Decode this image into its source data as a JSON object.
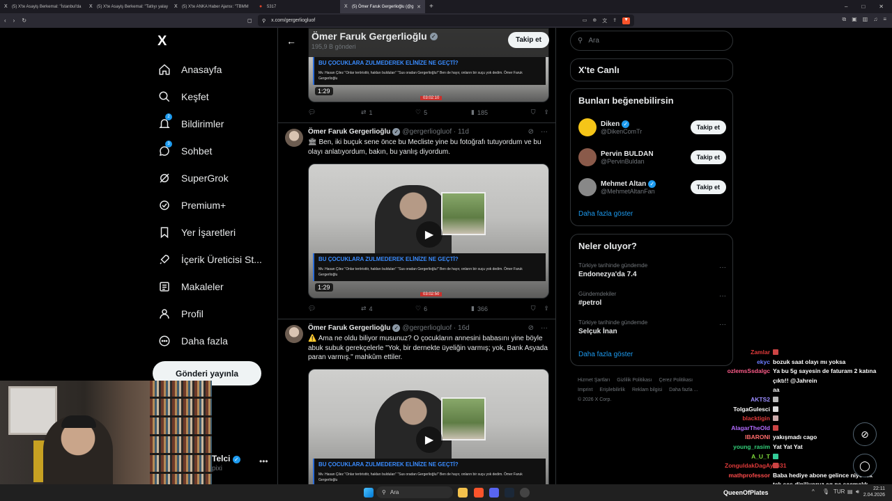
{
  "browser": {
    "tabs": [
      {
        "label": "(5) X'te Asayiş Berkemal: \"İstanbul'da",
        "active": false
      },
      {
        "label": "(5) X'te Asayiş Berkemal: \"Tatlıyı yalay",
        "active": false
      },
      {
        "label": "(5) X'te ANKA Haber Ajansı: \"TBMM",
        "active": false
      },
      {
        "label": "5317",
        "active": false
      },
      {
        "label": "(5) Ömer Faruk Gergerlioğlu (@g",
        "active": true
      }
    ],
    "new_tab": "+",
    "url": "x.com/gergerliogluof"
  },
  "sidebar": {
    "logo": "X",
    "items": [
      {
        "label": "Anasayfa",
        "icon": "home-icon",
        "badge": ""
      },
      {
        "label": "Keşfet",
        "icon": "search-icon",
        "badge": ""
      },
      {
        "label": "Bildirimler",
        "icon": "bell-icon",
        "badge": "2"
      },
      {
        "label": "Sohbet",
        "icon": "chat-icon",
        "badge": "3"
      },
      {
        "label": "SuperGrok",
        "icon": "grok-icon",
        "badge": ""
      },
      {
        "label": "Premium+",
        "icon": "premium-icon",
        "badge": ""
      },
      {
        "label": "Yer İşaretleri",
        "icon": "bookmark-icon",
        "badge": ""
      },
      {
        "label": "İçerik Üreticisi St...",
        "icon": "rocket-icon",
        "badge": ""
      },
      {
        "label": "Makaleler",
        "icon": "article-icon",
        "badge": ""
      },
      {
        "label": "Profil",
        "icon": "person-icon",
        "badge": ""
      },
      {
        "label": "Daha fazla",
        "icon": "more-icon",
        "badge": ""
      }
    ],
    "post_button": "Gönderi yayınla",
    "account_name": "Telci",
    "account_handle": "pixi"
  },
  "profile_header": {
    "name": "Ömer Faruk Gergerlioğlu",
    "subtitle": "195,9 B gönderi",
    "follow": "Takip et"
  },
  "posts": [
    {
      "author": "",
      "handle": "",
      "time": "",
      "text": "",
      "caption_title": "BU ÇOCUKLARA ZULMEDEREK ELİNİZE NE GEÇTİ?",
      "caption_body": "Mv. Hasan Çilez \"Onlar teröristtir, hakları bulduları\" \"Sus oradan Gergerlioğlu!\" Ben de hayır, onların bir suçu yok dedim. Ömer Faruk Gergerlioğlu",
      "duration": "1:29",
      "red_tag": "03:02:10",
      "replies": "",
      "reposts": "1",
      "likes": "5",
      "views": "185"
    },
    {
      "author": "Ömer Faruk Gergerlioğlu",
      "handle": "@gergerliogluof · 11d",
      "time": "",
      "emoji": "🏛",
      "text": "Ben, iki buçuk sene önce bu Mecliste yine bu fotoğrafı tutuyordum ve bu olayı anlatıyordum, bakın, bu yanlış diyordum.",
      "caption_title": "BU ÇOCUKLARA ZULMEDEREK ELİNİZE NE GEÇTİ?",
      "caption_body": "Mv. Hasan Çilez \"Onlar teröristtir, hakları bulduları\" \"Sus oradan Gergerlioğlu!\" Ben de hayır, onların bir suçu yok dedim. Ömer Faruk Gergerlioğlu",
      "duration": "1:29",
      "red_tag": "03:02:50",
      "replies": "",
      "reposts": "4",
      "likes": "6",
      "views": "366"
    },
    {
      "author": "Ömer Faruk Gergerlioğlu",
      "handle": "@gergerliogluof · 16d",
      "time": "",
      "emoji": "⚠️",
      "text": "Ama ne oldu biliyor musunuz? O çocukların annesini babasını yine böyle abuk subuk gerekçelerle \"Yok, bir dernekte üyeliğin varmış; yok, Bank Asyada paran varmış.\" mahkûm ettiler.",
      "caption_title": "BU ÇOCUKLARA ZULMEDEREK ELİNİZE NE GEÇTİ?",
      "caption_body": "Mv. Hasan Çilez \"Onlar teröristtir, hakları bulduları\" \"Sus oradan Gergerlioğlu!\" Ben de hayır, onların bir suçu yok dedim. Ömer Faruk Gergerlioğlu"
    }
  ],
  "right": {
    "search_placeholder": "Ara",
    "live_title": "X'te Canlı",
    "suggest_title": "Bunları beğenebilirsin",
    "suggestions": [
      {
        "name": "Diken",
        "handle": "@DikenComTr",
        "button": "Takip et",
        "color": "#f5c518"
      },
      {
        "name": "Pervin BULDAN",
        "handle": "@PervinBuldan",
        "button": "Takip et",
        "color": "#8a5a4a"
      },
      {
        "name": "Mehmet Altan",
        "handle": "@MehmetAltanFan",
        "button": "Takip et",
        "color": "#888888"
      }
    ],
    "show_more": "Daha fazla göster",
    "trends_title": "Neler oluyor?",
    "trends": [
      {
        "context": "Türkiye tarihinde gündemde",
        "topic": "Endonezya'da 7.4"
      },
      {
        "context": "Gündemdekiler",
        "topic": "#petrol"
      },
      {
        "context": "Türkiye tarihinde gündemde",
        "topic": "Selçuk İnan"
      }
    ],
    "trends_more": "Daha fazla göster",
    "footer": [
      "Hizmet Şartları",
      "Gizlilik Politikası",
      "Çerez Politikası",
      "Imprint",
      "Erişilebilirlik",
      "Reklam bilgisi",
      "Daha fazla ...",
      "© 2026 X Corp."
    ]
  },
  "chat": [
    {
      "user": "Zamlar",
      "color": "#e03a3a",
      "msg": ""
    },
    {
      "user": "ekyc",
      "color": "#6b7cff",
      "msg": "bozuk saat olayı mı yoksa"
    },
    {
      "user": "ozlemsSsdalgc",
      "color": "#ff5c8a",
      "msg": "Ya bu 5g sayesin de faturam 2 katına"
    },
    {
      "user": "",
      "color": "#ffffff",
      "msg": "çıktı!! @Jahrein"
    },
    {
      "user": "",
      "color": "#ffffff",
      "msg": "aa"
    },
    {
      "user": "AKTS2",
      "color": "#9b8cff",
      "msg": ""
    },
    {
      "user": "TolgaGulesci",
      "color": "#ffffff",
      "msg": ""
    },
    {
      "user": "blacktigin",
      "color": "#e03a3a",
      "msg": ""
    },
    {
      "user": "AlagarTheOld",
      "color": "#b36bff",
      "msg": ""
    },
    {
      "user": "IBARONI",
      "color": "#ff6b6b",
      "msg": "yakışmadı cago"
    },
    {
      "user": "young_rasim",
      "color": "#33d17a",
      "msg": "Yat Yat Yat"
    },
    {
      "user": "A_U_T",
      "color": "#7fdc3c",
      "msg": ""
    },
    {
      "user": "ZonguldakDagAyisi31",
      "color": "#e03a3a",
      "msg": ""
    },
    {
      "user": "mathprofessor",
      "color": "#ff4b4b",
      "msg": "Baba hediye abone gelince niye tek"
    },
    {
      "user": "",
      "color": "#ffffff",
      "msg": "tek ses diniliyoruz aq ne saçmalık"
    }
  ],
  "taskbar": {
    "search": "Ara",
    "user_label": "QueenOfPlates",
    "lang": "TUR",
    "time": "22:11",
    "date": "2.04.2026"
  }
}
